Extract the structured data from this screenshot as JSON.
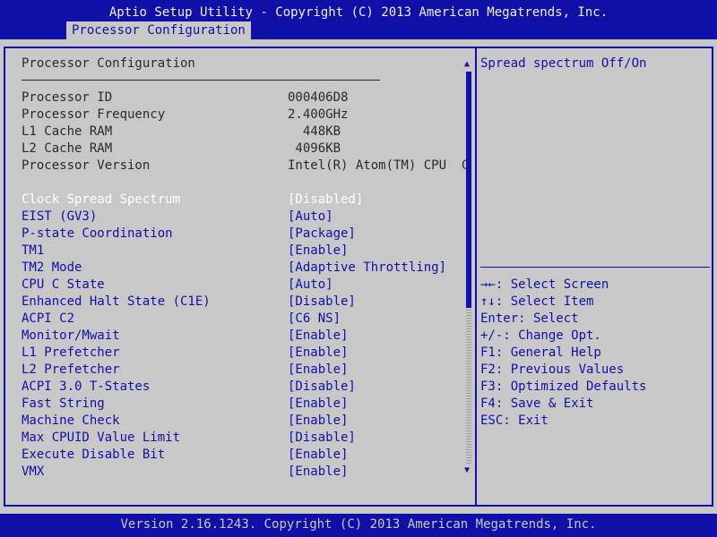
{
  "header": {
    "title": "Aptio Setup Utility - Copyright (C) 2013 American Megatrends, Inc.",
    "tab": "Processor Configuration"
  },
  "left": {
    "section_title": "Processor Configuration",
    "info": [
      {
        "label": "Processor ID",
        "value": "000406D8"
      },
      {
        "label": "Processor Frequency",
        "value": "2.400GHz"
      },
      {
        "label": "L1 Cache RAM",
        "value": "  448KB"
      },
      {
        "label": "L2 Cache RAM",
        "value": " 4096KB"
      },
      {
        "label": "Processor Version",
        "value": "Intel(R) Atom(TM) CPU  C"
      }
    ],
    "settings": [
      {
        "label": "Clock Spread Spectrum",
        "value": "[Disabled]"
      },
      {
        "label": "EIST (GV3)",
        "value": "[Auto]"
      },
      {
        "label": "P-state Coordination",
        "value": "[Package]"
      },
      {
        "label": "TM1",
        "value": "[Enable]"
      },
      {
        "label": "TM2 Mode",
        "value": "[Adaptive Throttling]"
      },
      {
        "label": "CPU C State",
        "value": "[Auto]"
      },
      {
        "label": "Enhanced Halt State (C1E)",
        "value": "[Disable]"
      },
      {
        "label": "ACPI C2",
        "value": "[C6 NS]"
      },
      {
        "label": "Monitor/Mwait",
        "value": "[Enable]"
      },
      {
        "label": "L1 Prefetcher",
        "value": "[Enable]"
      },
      {
        "label": "L2 Prefetcher",
        "value": "[Enable]"
      },
      {
        "label": "ACPI 3.0 T-States",
        "value": "[Disable]"
      },
      {
        "label": "Fast String",
        "value": "[Enable]"
      },
      {
        "label": "Machine Check",
        "value": "[Enable]"
      },
      {
        "label": "Max CPUID Value Limit",
        "value": "[Disable]"
      },
      {
        "label": "Execute Disable Bit",
        "value": "[Enable]"
      },
      {
        "label": "VMX",
        "value": "[Enable]"
      }
    ]
  },
  "right": {
    "help": "Spread spectrum Off/On",
    "keys": [
      "→←: Select Screen",
      "↑↓: Select Item",
      "Enter: Select",
      "+/-: Change Opt.",
      "F1: General Help",
      "F2: Previous Values",
      "F3: Optimized Defaults",
      "F4: Save & Exit",
      "ESC: Exit"
    ]
  },
  "scroll": {
    "position_fraction": 0.0,
    "visible_fraction": 0.6
  },
  "footer": "Version 2.16.1243. Copyright (C) 2013 American Megatrends, Inc.",
  "colors": {
    "background": "#c8c8c8",
    "bar": "#1010a8",
    "text": "#2a2a2a",
    "highlight": "#ffffff"
  }
}
